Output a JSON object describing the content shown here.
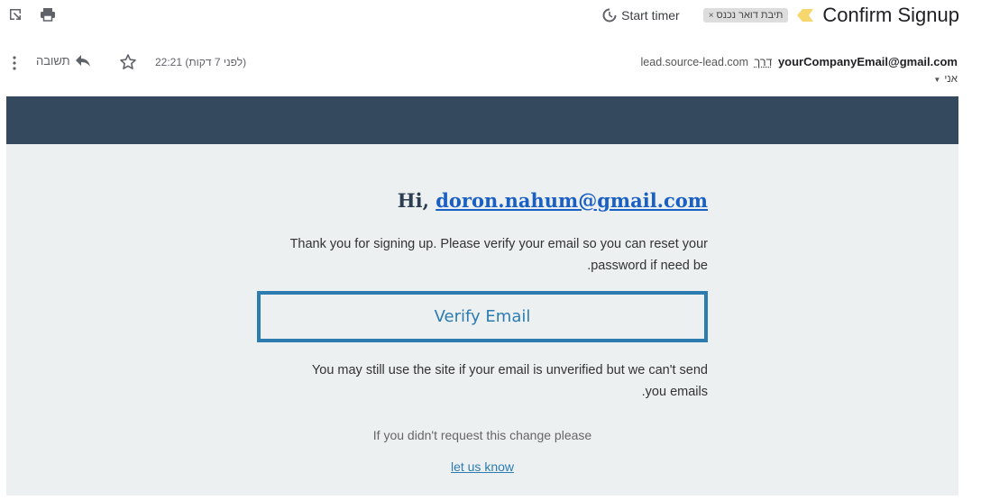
{
  "toolbar": {
    "icons": [
      "open-in-new-window-icon",
      "print-icon"
    ],
    "start_timer": "Start timer",
    "label_chip": "תיבת דואר נכנס",
    "label_chip_remove": "×",
    "subject": "Confirm Signup",
    "importance_color": "#f5d76e"
  },
  "sender": {
    "email": "yourCompanyEmail@gmail.com",
    "via": "דרך",
    "via_domain": "lead.source-lead.com",
    "to": "אני",
    "time": "22:21 (לפני 7 דקות)",
    "reply_label": "תשובה"
  },
  "email": {
    "header_color": "#34495e",
    "body_bg": "#ecf0f1",
    "greeting_prefix": "Hi,",
    "greeting_email": "doron.nahum@gmail.com",
    "para1_line1": "Thank you for signing up. Please verify your email so you can reset your",
    "para1_line2": ".password if need be",
    "verify_button": "Verify Email",
    "para2_line1": "You may still use the site if your email is unverified but we can't send",
    "para2_line2": ".you emails",
    "footer_note": "If you didn't request this change please",
    "footer_link": "let us know",
    "accent_color": "#2c7cb0"
  }
}
